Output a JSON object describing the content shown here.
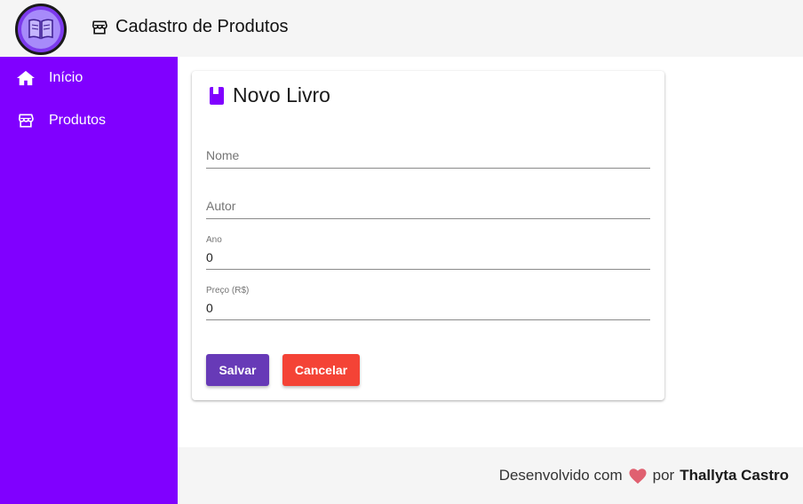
{
  "header": {
    "title": "Cadastro de Produtos",
    "logo_icon": "open-book-icon",
    "title_icon": "store-icon"
  },
  "sidebar": {
    "background": "#8000ff",
    "items": [
      {
        "label": "Início",
        "icon": "home-icon"
      },
      {
        "label": "Produtos",
        "icon": "store-icon"
      }
    ]
  },
  "form": {
    "title": "Novo Livro",
    "title_icon": "book-icon",
    "fields": {
      "nome": {
        "label": "Nome",
        "value": ""
      },
      "autor": {
        "label": "Autor",
        "value": ""
      },
      "ano": {
        "label": "Ano",
        "value": "0"
      },
      "preco": {
        "label": "Preço (R$)",
        "value": "0"
      }
    },
    "save_label": "Salvar",
    "cancel_label": "Cancelar",
    "save_color": "#673ab7",
    "cancel_color": "#f44336"
  },
  "footer": {
    "prefix": "Desenvolvido com",
    "heart_icon": "heart-icon",
    "by": "por",
    "author": "Thallyta Castro"
  }
}
